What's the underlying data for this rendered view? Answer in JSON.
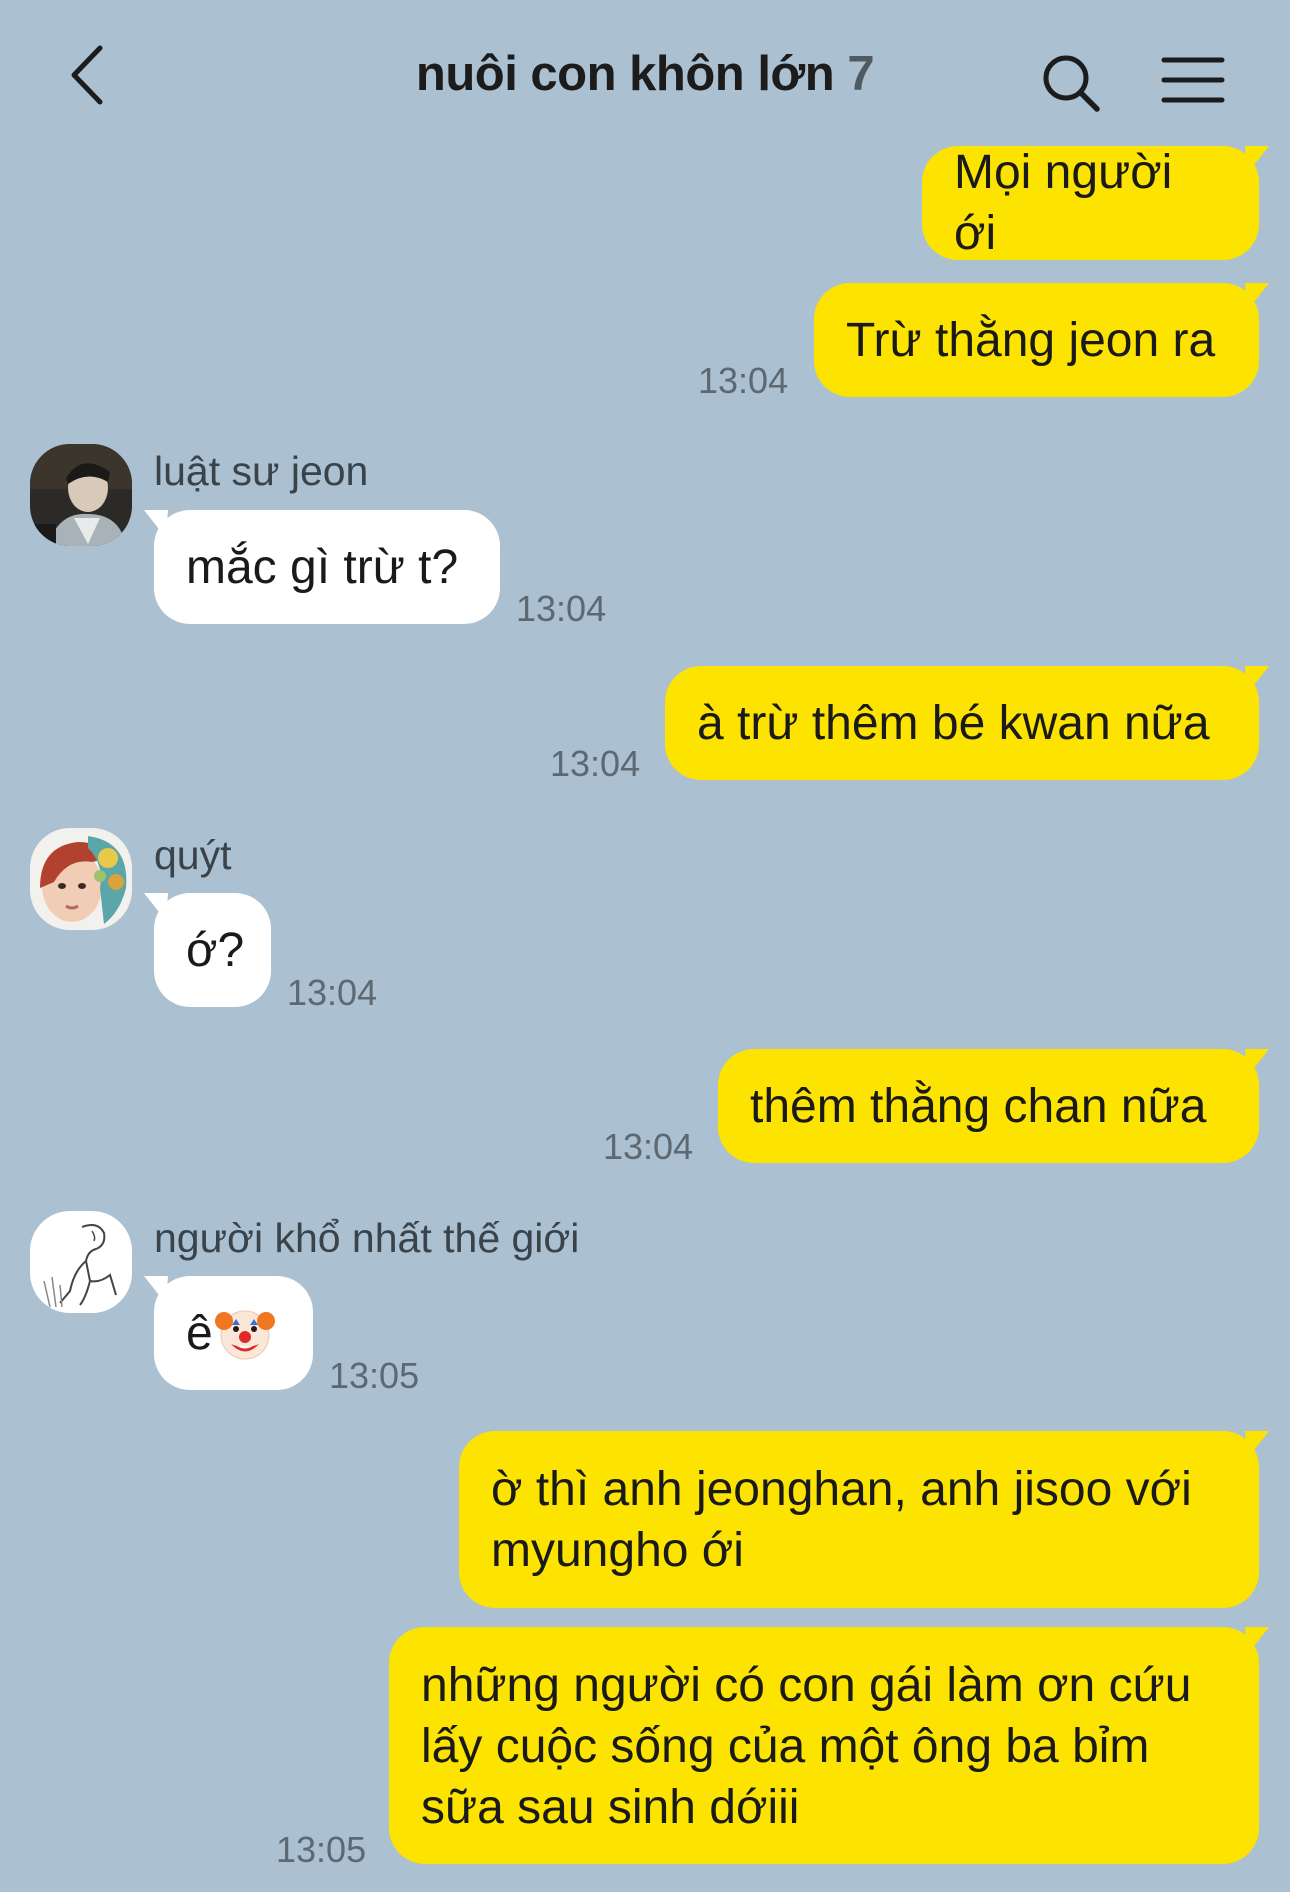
{
  "header": {
    "title": "nuôi con khôn lớn",
    "member_count": "7",
    "back_icon": "chevron-left-icon",
    "search_icon": "search-icon",
    "menu_icon": "hamburger-menu-icon"
  },
  "colors": {
    "background": "#abc1d1",
    "my_bubble": "#fde300",
    "their_bubble": "#ffffff"
  },
  "messages": [
    {
      "text": "Mọi người ới"
    },
    {
      "text": "Trừ thằng jeon ra",
      "time": "13:04"
    },
    {
      "sender": "luật sư jeon",
      "text": "mắc gì trừ t?",
      "time": "13:04"
    },
    {
      "text": "à trừ thêm bé kwan nữa",
      "time": "13:04"
    },
    {
      "sender": "quýt",
      "text": "ớ?",
      "time": "13:04"
    },
    {
      "text": "thêm thằng chan nữa",
      "time": "13:04"
    },
    {
      "sender": "người khổ nhất thế giới",
      "text": "ê",
      "emoji": "clown-face",
      "time": "13:05"
    },
    {
      "lines": [
        "ờ thì anh jeonghan, anh jisoo với",
        "myungho ới"
      ]
    },
    {
      "lines": [
        "những người có con gái làm ơn cứu",
        "lấy cuộc sống của một ông ba bỉm",
        "sữa sau sinh dớiii"
      ],
      "time": "13:05"
    }
  ]
}
